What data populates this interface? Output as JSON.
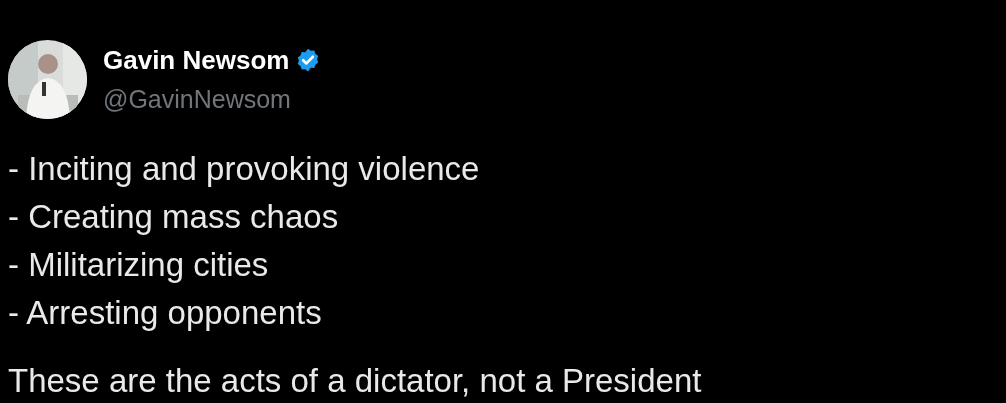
{
  "author": {
    "name": "Gavin Newsom",
    "verified": true,
    "handle": "@GavinNewsom"
  },
  "body": {
    "lines": [
      "- Inciting and provoking violence",
      "- Creating mass chaos",
      "- Militarizing cities",
      "- Arresting opponents"
    ],
    "closing": "These are the acts of a dictator, not a President"
  }
}
